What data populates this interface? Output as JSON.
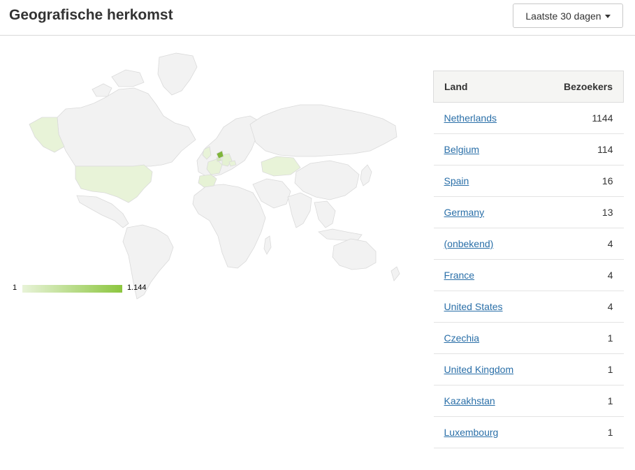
{
  "header": {
    "title": "Geografische herkomst",
    "range_label": "Laatste 30 dagen"
  },
  "legend": {
    "min": "1",
    "max": "1.144"
  },
  "colors": {
    "land": "#f2f2f2",
    "border": "#dadada",
    "low": "#e8f3d8",
    "high": "#8cc63f",
    "link": "#2a6fa8"
  },
  "table": {
    "columns": [
      "Land",
      "Bezoekers"
    ],
    "rows": [
      {
        "country": "Netherlands",
        "visitors": "1144"
      },
      {
        "country": "Belgium",
        "visitors": "114"
      },
      {
        "country": "Spain",
        "visitors": "16"
      },
      {
        "country": "Germany",
        "visitors": "13"
      },
      {
        "country": "(onbekend)",
        "visitors": "4"
      },
      {
        "country": "France",
        "visitors": "4"
      },
      {
        "country": "United States",
        "visitors": "4"
      },
      {
        "country": "Czechia",
        "visitors": "1"
      },
      {
        "country": "United Kingdom",
        "visitors": "1"
      },
      {
        "country": "Kazakhstan",
        "visitors": "1"
      },
      {
        "country": "Luxembourg",
        "visitors": "1"
      }
    ]
  }
}
